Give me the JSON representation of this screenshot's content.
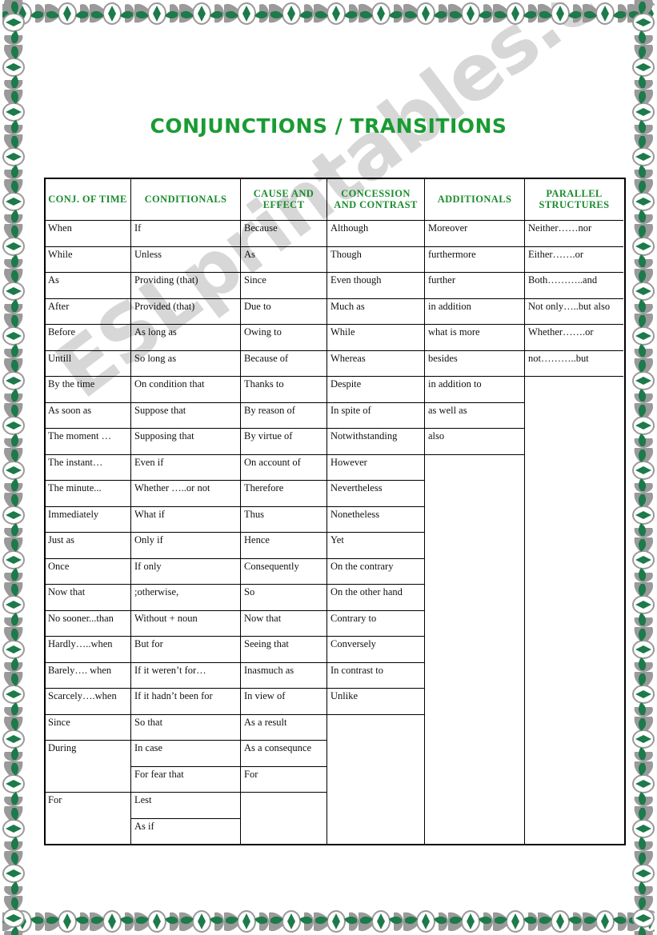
{
  "title": "CONJUNCTIONS / TRANSITIONS",
  "watermark": "ESLprintables.com",
  "colors": {
    "title_green": "#1a9b33",
    "header_green": "#1a8c2e",
    "border_ornament_green": "#1d7a4a",
    "border_ornament_gray": "#9a9a9a",
    "watermark_gray": "#c9c9c9"
  },
  "table": {
    "headers": [
      "CONJ. OF TIME",
      "CONDITIONALS",
      "CAUSE AND EFFECT",
      "CONCESSION AND CONTRAST",
      "ADDITIONALS",
      "PARALLEL STRUCTURES"
    ],
    "columns": [
      {
        "name": "conj-of-time",
        "items": [
          "When",
          "While",
          "As",
          "After",
          "Before",
          "Untill",
          "By the time",
          "As soon as",
          "The moment …",
          "The instant…",
          "The minute...",
          "Immediately",
          "Just as",
          "Once",
          "Now that",
          "No sooner...than",
          "Hardly…..when",
          "Barely…. when",
          "Scarcely….when",
          "Since",
          "During",
          "",
          "For",
          ""
        ]
      },
      {
        "name": "conditionals",
        "items": [
          "If",
          "Unless",
          "Providing (that)",
          "Provided (that)",
          "As long as",
          "So long as",
          "On condition that",
          "Suppose that",
          "Supposing that",
          "Even if",
          "Whether …..or not",
          "What if",
          "Only if",
          "If only",
          ";otherwise,",
          "Without + noun",
          "But for",
          "If it weren’t for…",
          "If it hadn’t been for",
          "So that",
          "In case",
          "For fear that",
          "Lest",
          "As if"
        ]
      },
      {
        "name": "cause-and-effect",
        "items": [
          "Because",
          "As",
          "Since",
          "Due to",
          "Owing to",
          "Because of",
          "Thanks to",
          "By reason of",
          "By virtue of",
          "On account of",
          "Therefore",
          "Thus",
          "Hence",
          "Consequently",
          "So",
          "Now that",
          "Seeing that",
          "Inasmuch as",
          "In view of",
          "As a result",
          "As a consequnce",
          "For"
        ]
      },
      {
        "name": "concession-and-contrast",
        "items": [
          "Although",
          "Though",
          "Even though",
          "Much as",
          "While",
          "Whereas",
          "Despite",
          "In spite of",
          "Notwithstanding",
          "However",
          "Nevertheless",
          "Nonetheless",
          "Yet",
          "On the contrary",
          "On the other hand",
          "Contrary to",
          "Conversely",
          "In contrast to",
          "Unlike"
        ]
      },
      {
        "name": "additionals",
        "items": [
          "Moreover",
          "furthermore",
          "further",
          "in addition",
          "what is more",
          "besides",
          "in addition to",
          "as well as",
          "also"
        ]
      },
      {
        "name": "parallel-structures",
        "items": [
          "Neither……nor",
          "Either…….or",
          "Both………..and",
          "Not only…..but also",
          "Whether…….or",
          "not………..but"
        ]
      }
    ]
  }
}
